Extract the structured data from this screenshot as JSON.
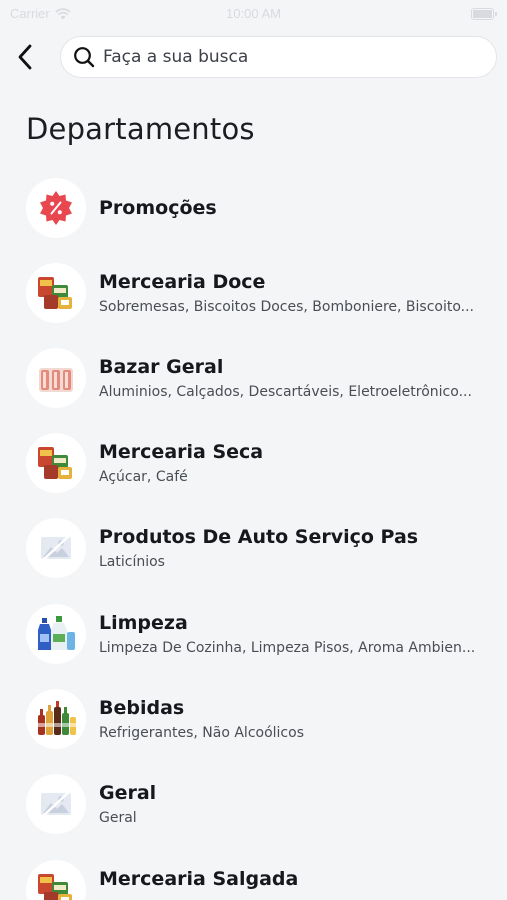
{
  "status_bar": {
    "carrier": "Carrier",
    "time": "10:00 AM"
  },
  "search": {
    "placeholder": "Faça a sua busca",
    "value": ""
  },
  "page": {
    "title": "Departamentos"
  },
  "departments": [
    {
      "name": "Promoções",
      "subtitle": "",
      "icon": "promo-badge-icon"
    },
    {
      "name": "Mercearia Doce",
      "subtitle": "Sobremesas, Biscoitos Doces, Bomboniere, Biscoito...",
      "icon": "grocery-products-icon"
    },
    {
      "name": "Bazar Geral",
      "subtitle": "Aluminios, Calçados, Descartáveis, Eletroeletrônico...",
      "icon": "bazaar-products-icon"
    },
    {
      "name": "Mercearia Seca",
      "subtitle": "Açúcar, Café",
      "icon": "grocery-products-icon"
    },
    {
      "name": "Produtos De Auto Serviço Pas",
      "subtitle": "Laticínios",
      "icon": "image-placeholder-icon"
    },
    {
      "name": "Limpeza",
      "subtitle": "Limpeza De Cozinha, Limpeza Pisos, Aroma Ambien...",
      "icon": "cleaning-products-icon"
    },
    {
      "name": "Bebidas",
      "subtitle": "Refrigerantes, Não Alcoólicos",
      "icon": "drinks-bottles-icon"
    },
    {
      "name": "Geral",
      "subtitle": "Geral",
      "icon": "image-placeholder-icon"
    },
    {
      "name": "Mercearia Salgada",
      "subtitle": "",
      "icon": "grocery-products-icon"
    }
  ],
  "colors": {
    "background": "#f4f5f7",
    "promo_red": "#e8474f",
    "text_primary": "#16181d",
    "text_secondary": "#4a4d55"
  }
}
